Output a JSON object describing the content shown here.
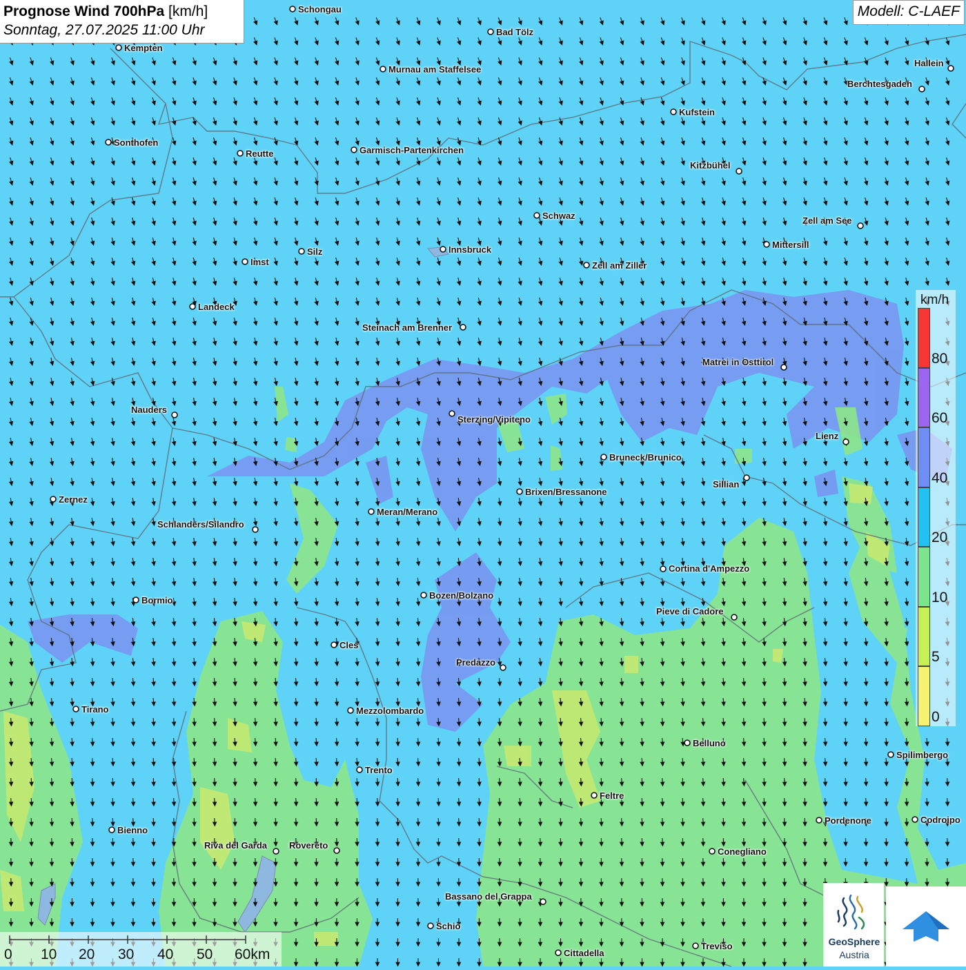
{
  "header": {
    "title_bold": "Prognose Wind 700hPa",
    "title_unit": "[km/h]",
    "datetime": "Sonntag, 27.07.2025 11:00 Uhr",
    "model": "Modell: C-LAEF"
  },
  "legend": {
    "unit": "km/h",
    "levels": [
      {
        "label": "80",
        "color": "#f63535"
      },
      {
        "label": "60",
        "color": "#9a66ee"
      },
      {
        "label": "40",
        "color": "#6f8ef4"
      },
      {
        "label": "20",
        "color": "#23c1f0"
      },
      {
        "label": "10",
        "color": "#7ee38e"
      },
      {
        "label": "5",
        "color": "#c7ef56"
      },
      {
        "label": "0",
        "color": "#f6f272"
      }
    ]
  },
  "scalebar": {
    "labels": [
      "0",
      "10",
      "20",
      "30",
      "40",
      "50",
      "60km"
    ]
  },
  "cities": [
    {
      "name": "Schongau"
    },
    {
      "name": "Bad Tölz"
    },
    {
      "name": "Kempten"
    },
    {
      "name": "Hallein"
    },
    {
      "name": "Murnau am Staffelsee"
    },
    {
      "name": "Berchtesgaden"
    },
    {
      "name": "Kufstein"
    },
    {
      "name": "Sonthofen"
    },
    {
      "name": "Reutte"
    },
    {
      "name": "Garmisch-Partenkirchen"
    },
    {
      "name": "Kitzbühel"
    },
    {
      "name": "Schwaz"
    },
    {
      "name": "Zell am See"
    },
    {
      "name": "Silz"
    },
    {
      "name": "Innsbruck"
    },
    {
      "name": "Mittersill"
    },
    {
      "name": "Imst"
    },
    {
      "name": "Zell am Ziller"
    },
    {
      "name": "Landeck"
    },
    {
      "name": "Steinach am Brenner"
    },
    {
      "name": "Matrei in Osttirol"
    },
    {
      "name": "Nauders"
    },
    {
      "name": "Sterzing/Vipiteno"
    },
    {
      "name": "Lienz"
    },
    {
      "name": "Bruneck/Brunico"
    },
    {
      "name": "Sillian"
    },
    {
      "name": "Zernez"
    },
    {
      "name": "Brixen/Bressanone"
    },
    {
      "name": "Meran/Merano"
    },
    {
      "name": "Schlanders/Silandro"
    },
    {
      "name": "Cortina d'Ampezzo"
    },
    {
      "name": "Bozen/Bolzano"
    },
    {
      "name": "Bormio"
    },
    {
      "name": "Pieve di Cadore"
    },
    {
      "name": "Cles"
    },
    {
      "name": "Predazzo"
    },
    {
      "name": "Tirano"
    },
    {
      "name": "Mezzolombardo"
    },
    {
      "name": "Belluno"
    },
    {
      "name": "Spilimbergo"
    },
    {
      "name": "Trento"
    },
    {
      "name": "Feltre"
    },
    {
      "name": "Pordenone"
    },
    {
      "name": "Codroipo"
    },
    {
      "name": "Bienno"
    },
    {
      "name": "Riva del Garda"
    },
    {
      "name": "Rovereto"
    },
    {
      "name": "Conegliano"
    },
    {
      "name": "Bassano del Grappa"
    },
    {
      "name": "Schio"
    },
    {
      "name": "Cittadella"
    },
    {
      "name": "Treviso"
    }
  ],
  "logos": {
    "geosphere_line1": "GeoSphere",
    "geosphere_line2": "Austria"
  },
  "wind_direction": "north-northwest"
}
